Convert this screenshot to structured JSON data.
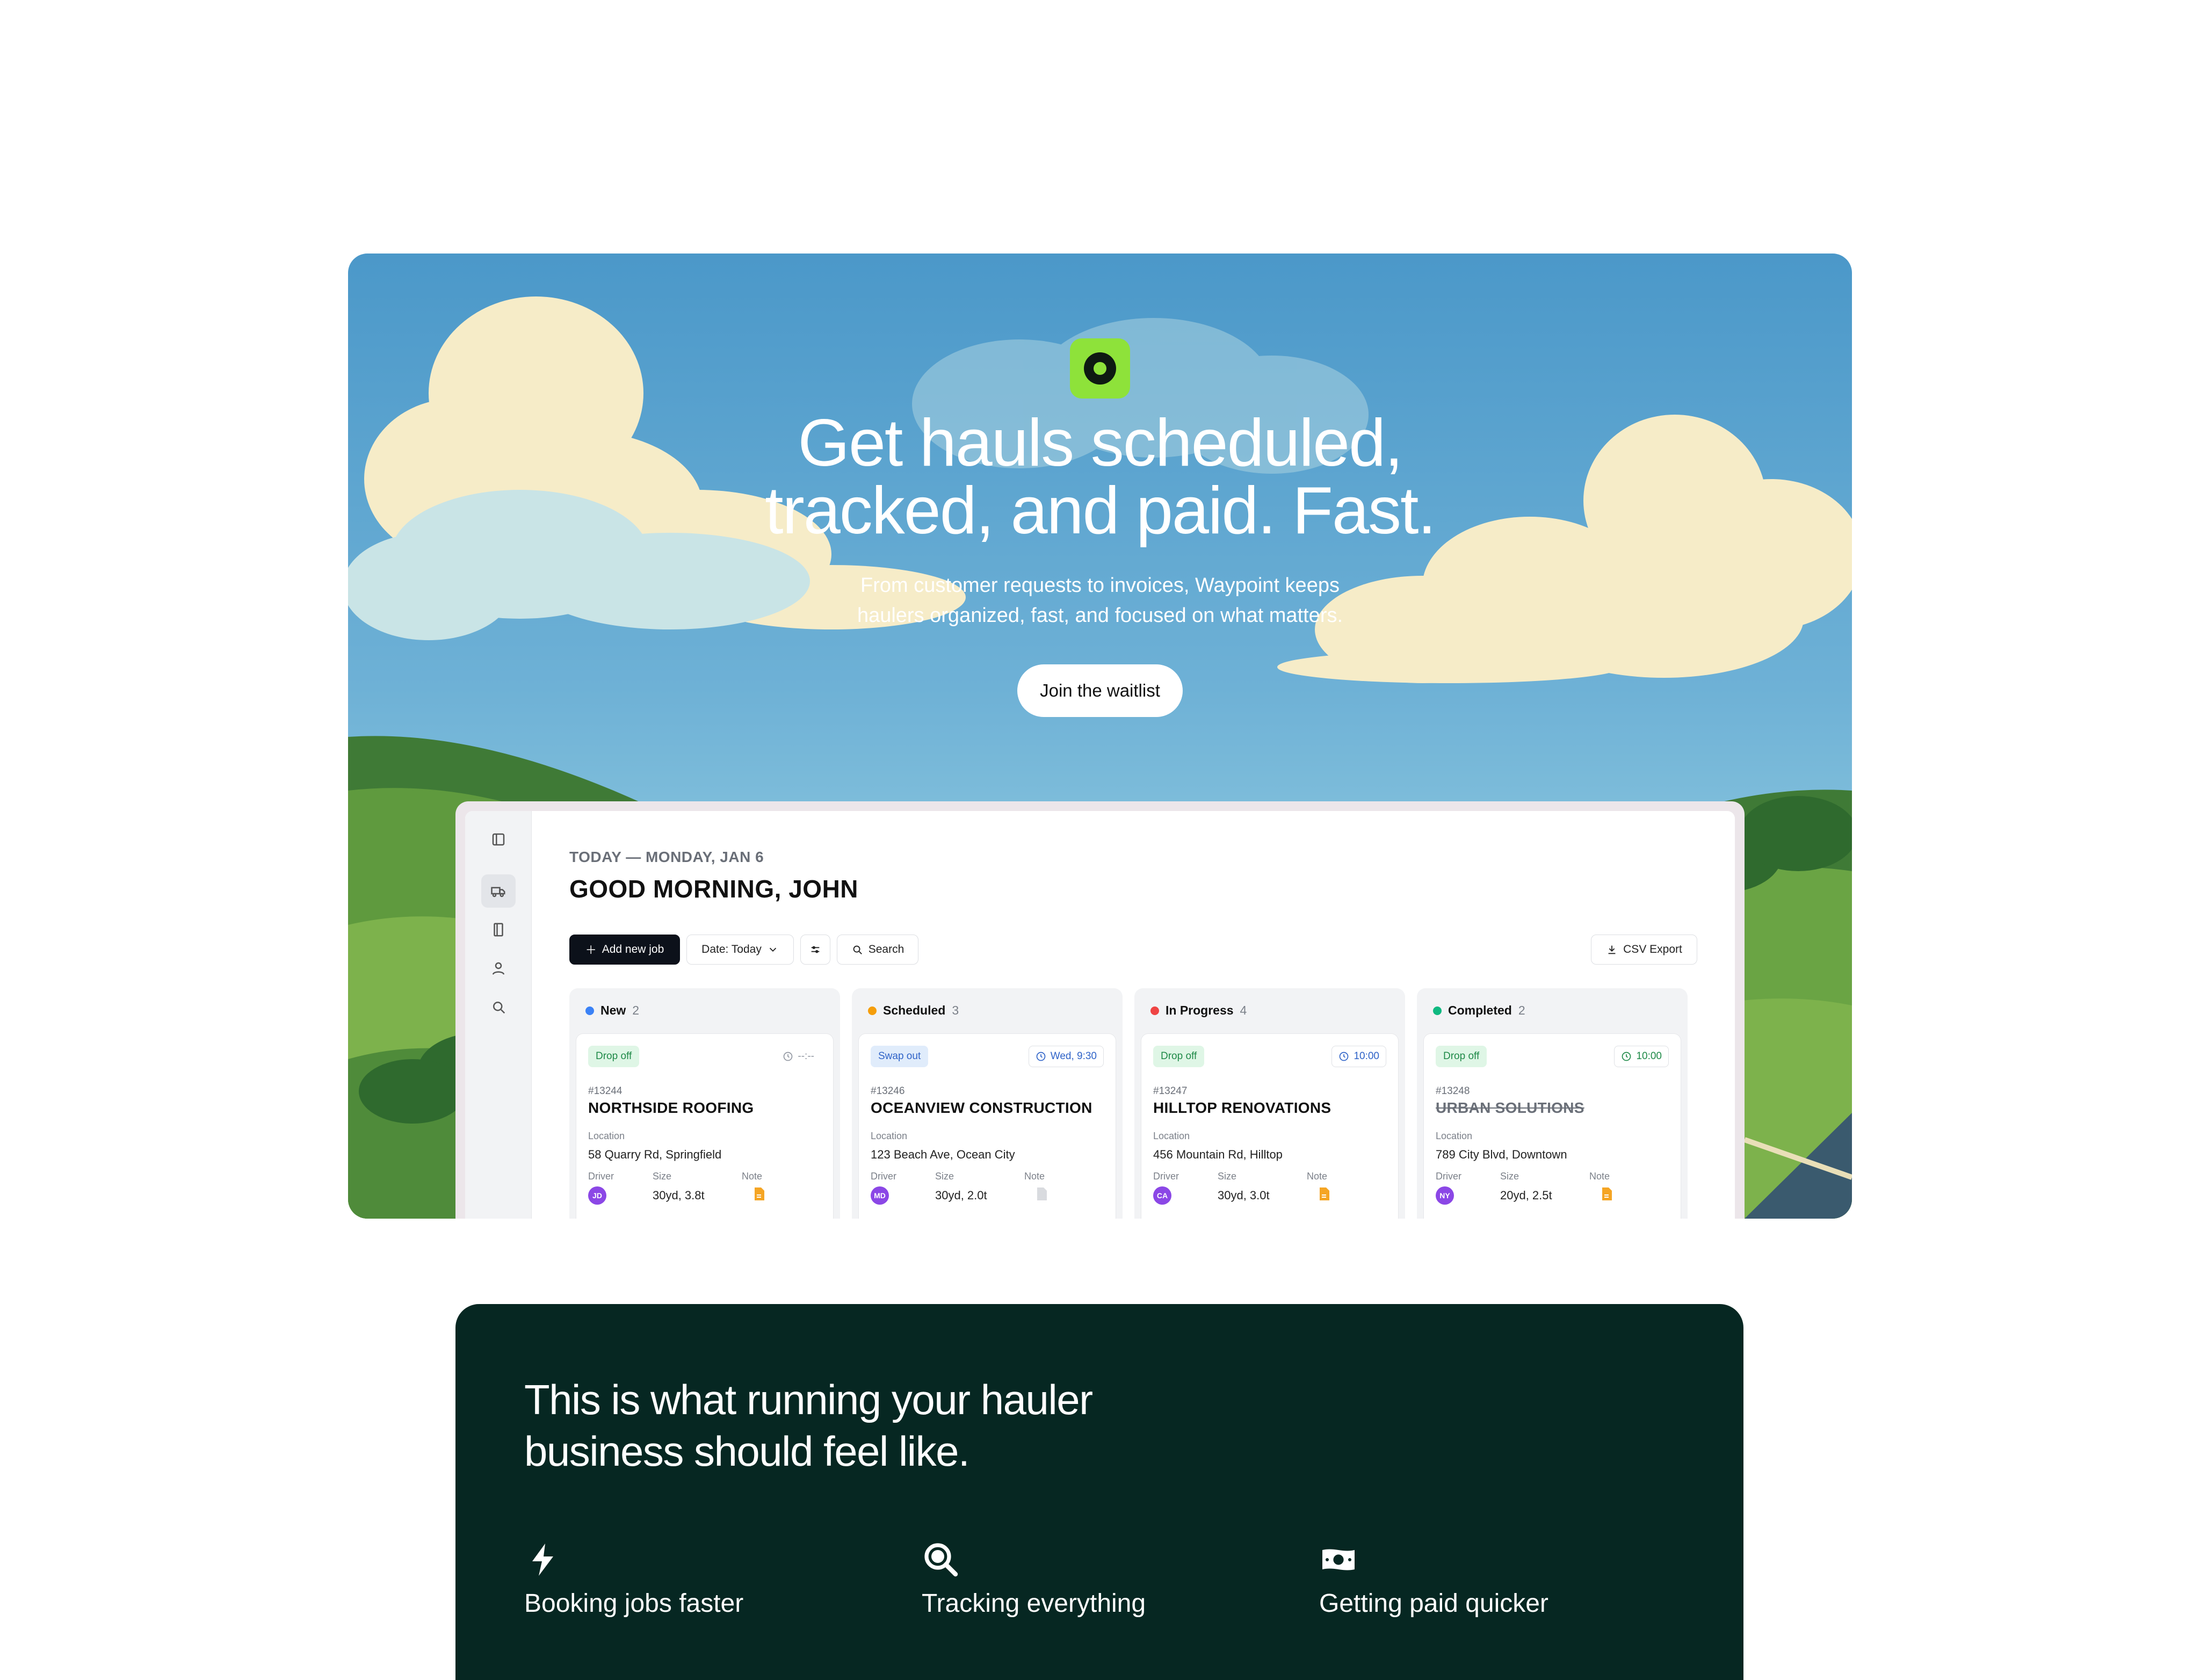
{
  "hero": {
    "title_line1": "Get hauls scheduled,",
    "title_line2": "tracked, and paid. Fast.",
    "subtitle_line1": "From customer requests to invoices, Waypoint keeps",
    "subtitle_line2": "haulers organized, fast, and focused on what matters.",
    "cta_label": "Join the waitlist",
    "logo_icon": "target-logo-icon",
    "colors": {
      "logo_bg": "#8ee23a",
      "logo_fg": "#0e1a12",
      "sky": "#4b98c9"
    }
  },
  "app": {
    "sidebar": {
      "items": [
        {
          "icon": "sidebar-toggle-icon"
        },
        {
          "icon": "truck-icon",
          "active": true
        },
        {
          "icon": "book-icon"
        },
        {
          "icon": "user-icon"
        },
        {
          "icon": "search-icon"
        }
      ]
    },
    "date_line": "TODAY — MONDAY, JAN 6",
    "greeting": "GOOD MORNING, JOHN",
    "toolbar": {
      "add_label": "Add new job",
      "date_label": "Date: Today",
      "search_label": "Search",
      "export_label": "CSV Export"
    },
    "columns": [
      {
        "name": "New",
        "count": "2",
        "dot_color": "#3b82f6",
        "card": {
          "badge": "Drop off",
          "badge_style": "green",
          "time": "--:--",
          "time_style": "muted",
          "job_id": "#13244",
          "company": "NORTHSIDE ROOFING",
          "completed": false,
          "location_label": "Location",
          "location": "58 Quarry Rd, Springfield",
          "driver_label": "Driver",
          "driver_initials": "JD",
          "size_label": "Size",
          "size": "30yd, 3.8t",
          "note_label": "Note",
          "note_present": true
        }
      },
      {
        "name": "Scheduled",
        "count": "3",
        "dot_color": "#f59e0b",
        "card": {
          "badge": "Swap out",
          "badge_style": "blue",
          "time": "Wed, 9:30",
          "time_style": "blue",
          "job_id": "#13246",
          "company": "OCEANVIEW CONSTRUCTION",
          "completed": false,
          "location_label": "Location",
          "location": "123 Beach Ave, Ocean City",
          "driver_label": "Driver",
          "driver_initials": "MD",
          "size_label": "Size",
          "size": "30yd, 2.0t",
          "note_label": "Note",
          "note_present": false
        }
      },
      {
        "name": "In Progress",
        "count": "4",
        "dot_color": "#ef4444",
        "card": {
          "badge": "Drop off",
          "badge_style": "green",
          "time": "10:00",
          "time_style": "blue",
          "job_id": "#13247",
          "company": "HILLTOP RENOVATIONS",
          "completed": false,
          "location_label": "Location",
          "location": "456 Mountain Rd, Hilltop",
          "driver_label": "Driver",
          "driver_initials": "CA",
          "size_label": "Size",
          "size": "30yd, 3.0t",
          "note_label": "Note",
          "note_present": true
        }
      },
      {
        "name": "Completed",
        "count": "2",
        "dot_color": "#10b981",
        "card": {
          "badge": "Drop off",
          "badge_style": "green",
          "time": "10:00",
          "time_style": "green",
          "job_id": "#13248",
          "company": "URBAN SOLUTIONS",
          "completed": true,
          "location_label": "Location",
          "location": "789 City Blvd, Downtown",
          "driver_label": "Driver",
          "driver_initials": "NY",
          "size_label": "Size",
          "size": "20yd, 2.5t",
          "note_label": "Note",
          "note_present": true
        }
      }
    ]
  },
  "features": {
    "title_line1": "This is what running your hauler",
    "title_line2": "business should feel like.",
    "items": [
      {
        "label": "Booking jobs faster",
        "icon": "lightning-icon"
      },
      {
        "label": "Tracking everything",
        "icon": "magnifier-icon"
      },
      {
        "label": "Getting paid quicker",
        "icon": "cash-icon"
      }
    ],
    "colors": {
      "bg": "#062722"
    }
  }
}
